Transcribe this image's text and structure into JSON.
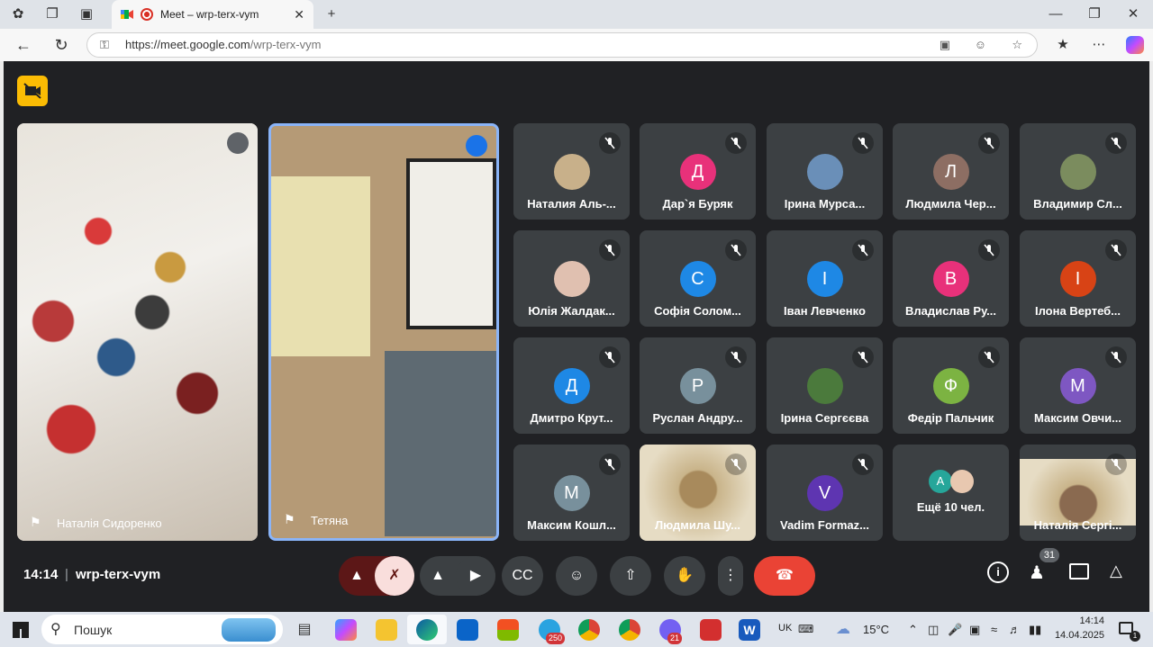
{
  "browser": {
    "tab_title": "Meet – wrp-terx-vym",
    "url_host": "https://meet.google.com",
    "url_path": "/wrp-terx-vym"
  },
  "meeting": {
    "time": "14:14",
    "code": "wrp-terx-vym",
    "participant_count": "31"
  },
  "big_tiles": [
    {
      "name": "Наталія Сидоренко"
    },
    {
      "name": "Тетяна"
    }
  ],
  "grid": [
    {
      "name": "Наталия Аль-...",
      "initial": "",
      "color": "#c8b08a"
    },
    {
      "name": "Дар`я Буряк",
      "initial": "Д",
      "color": "#e8317a"
    },
    {
      "name": "Ірина Мурса...",
      "initial": "",
      "color": "#6a8fb8"
    },
    {
      "name": "Людмила Чер...",
      "initial": "Л",
      "color": "#8d6e63"
    },
    {
      "name": "Владимир Сл...",
      "initial": "",
      "color": "#7b8c5e"
    },
    {
      "name": "Юлія Жалдак...",
      "initial": "",
      "color": "#e0c0b0"
    },
    {
      "name": "Софія Солом...",
      "initial": "С",
      "color": "#1e88e5"
    },
    {
      "name": "Іван Левченко",
      "initial": "І",
      "color": "#1e88e5"
    },
    {
      "name": "Владислав Ру...",
      "initial": "В",
      "color": "#e8317a"
    },
    {
      "name": "Ілона Вертеб...",
      "initial": "І",
      "color": "#d84315"
    },
    {
      "name": "Дмитро Крут...",
      "initial": "Д",
      "color": "#1e88e5"
    },
    {
      "name": "Руслан Андру...",
      "initial": "Р",
      "color": "#78909c"
    },
    {
      "name": "Ірина Сергєєва",
      "initial": "",
      "color": "#4b7a3c"
    },
    {
      "name": "Федір Пальчик",
      "initial": "Ф",
      "color": "#7cb342"
    },
    {
      "name": "Максим Овчи...",
      "initial": "М",
      "color": "#7e57c2"
    },
    {
      "name": "Максим Кошл...",
      "initial": "М",
      "color": "#78909c"
    },
    {
      "name": "Людмила Шу...",
      "initial": "",
      "color": "#a88a5c"
    },
    {
      "name": "Vadim Formaz...",
      "initial": "V",
      "color": "#5e35b1"
    },
    {
      "name": "Ещё 10 чел.",
      "initial": "A",
      "color": "#26a69a"
    },
    {
      "name": "Наталія Сергі...",
      "initial": "",
      "color": "#8a6a50"
    }
  ],
  "taskbar": {
    "search_label": "Пошук",
    "lang": "UK",
    "weather": "15°C",
    "clock_time": "14:14",
    "clock_date": "14.04.2025",
    "telegram_badge": "250",
    "viber_badge": "21",
    "notif_badge": "1"
  }
}
